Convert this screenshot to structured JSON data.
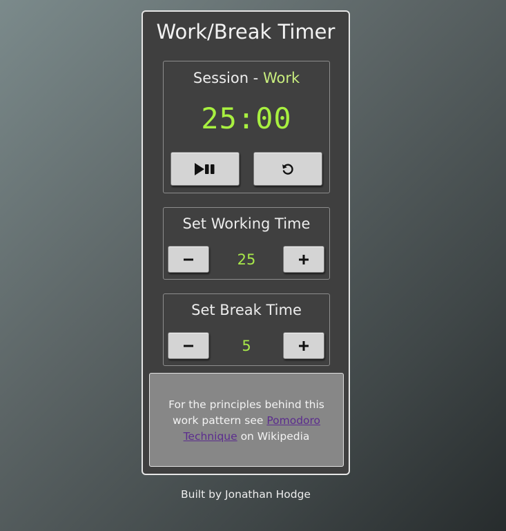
{
  "app": {
    "title": "Work/Break Timer"
  },
  "session": {
    "label": "Session - ",
    "mode": "Work",
    "time_display": "25:00",
    "play_pause_icon": "play-pause-icon",
    "reset_icon": "reset-icon"
  },
  "work_setting": {
    "title": "Set Working Time",
    "value": "25",
    "decrement_icon": "minus-icon",
    "increment_icon": "plus-icon"
  },
  "break_setting": {
    "title": "Set Break Time",
    "value": "5",
    "decrement_icon": "minus-icon",
    "increment_icon": "plus-icon"
  },
  "info": {
    "text_before": "For the principles behind this work pattern see ",
    "link_text": "Pomodoro Technique",
    "text_after": " on Wikipedia"
  },
  "footer": {
    "text": "Built by Jonathan Hodge"
  },
  "colors": {
    "accent_green": "#a8f040",
    "mode_green": "#c9ee7e",
    "link_purple": "#5b2c8e",
    "panel_bg": "#404040"
  }
}
